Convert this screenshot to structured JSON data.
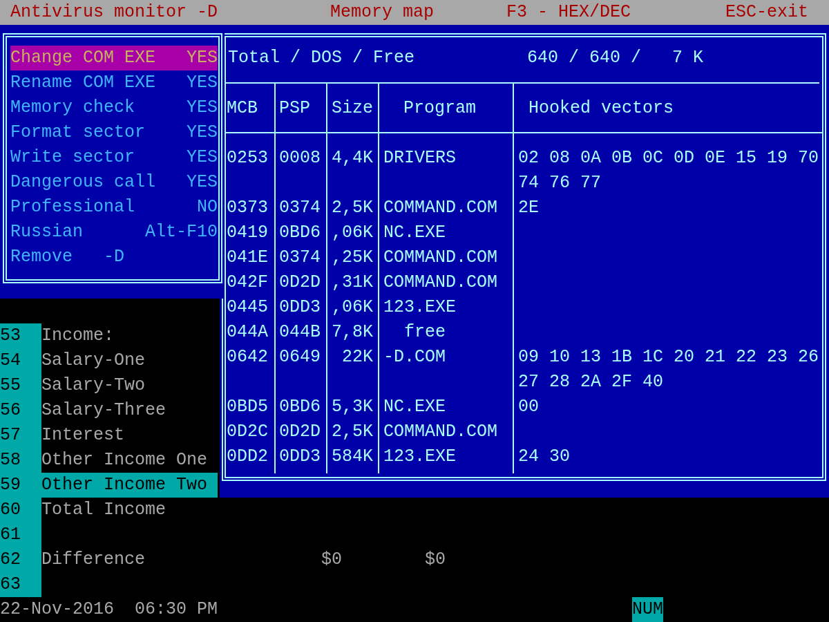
{
  "top_bar": {
    "program": "Antivirus monitor -D",
    "screen": "Memory map",
    "hint": "F3 - HEX/DEC",
    "exit": "ESC-exit"
  },
  "options": [
    {
      "label": "Change COM EXE",
      "value": "YES",
      "selected": true
    },
    {
      "label": "Rename COM EXE",
      "value": "YES",
      "selected": false
    },
    {
      "label": "Memory check",
      "value": "YES",
      "selected": false
    },
    {
      "label": "Format sector",
      "value": "YES",
      "selected": false
    },
    {
      "label": "Write sector",
      "value": "YES",
      "selected": false
    },
    {
      "label": "Dangerous call",
      "value": "YES",
      "selected": false
    },
    {
      "label": "Professional",
      "value": "NO",
      "selected": false
    },
    {
      "label": "Russian",
      "value": "Alt-F10",
      "selected": false
    },
    {
      "label": "Remove   -D",
      "selected": false
    }
  ],
  "memory_map": {
    "summary_label": "Total / DOS / Free",
    "summary_values": "640 / 640 /   7 K",
    "columns": [
      "MCB",
      "PSP",
      "Size",
      "Program",
      "Hooked vectors"
    ],
    "rows": [
      {
        "kind": "program",
        "mcb": "0253",
        "psp": "0008",
        "size": "4,4K",
        "program": "DRIVERS",
        "hooked": "02 08 0A 0B 0C 0D 0E 15 19 70 74 76 77"
      },
      {
        "kind": "program",
        "mcb": "0373",
        "psp": "0374",
        "size": "2,5K",
        "program": "COMMAND.COM",
        "hooked": "2E"
      },
      {
        "kind": "program",
        "mcb": "0419",
        "psp": "0BD6",
        "size": ",06K",
        "program": "NC.EXE"
      },
      {
        "kind": "program",
        "mcb": "041E",
        "psp": "0374",
        "size": ",25K",
        "program": "COMMAND.COM"
      },
      {
        "kind": "program",
        "mcb": "042F",
        "psp": "0D2D",
        "size": ",31K",
        "program": "COMMAND.COM"
      },
      {
        "kind": "program",
        "mcb": "0445",
        "psp": "0DD3",
        "size": ",06K",
        "program": "123.EXE"
      },
      {
        "kind": "free",
        "mcb": "044A",
        "psp": "044B",
        "size": "7,8K",
        "program": "free"
      },
      {
        "kind": "program",
        "mcb": "0642",
        "psp": "0649",
        "size": "22K",
        "program": "-D.COM",
        "hooked": "09 10 13 1B 1C 20 21 22 23 26 27 28 2A 2F 40"
      },
      {
        "kind": "program",
        "mcb": "0BD5",
        "psp": "0BD6",
        "size": "5,3K",
        "program": "NC.EXE",
        "hooked": "00"
      },
      {
        "kind": "program",
        "mcb": "0D2C",
        "psp": "0D2D",
        "size": "2,5K",
        "program": "COMMAND.COM"
      },
      {
        "kind": "program",
        "mcb": "0DD2",
        "psp": "0DD3",
        "size": "584K",
        "program": "123.EXE",
        "hooked": "24 30"
      }
    ]
  },
  "spreadsheet": {
    "rows": [
      {
        "number": "53",
        "label": "Income:",
        "selected": false
      },
      {
        "number": "54",
        "label": "Salary-One",
        "selected": false
      },
      {
        "number": "55",
        "label": "Salary-Two",
        "selected": false
      },
      {
        "number": "56",
        "label": "Salary-Three",
        "selected": false
      },
      {
        "number": "57",
        "label": "Interest",
        "selected": false
      },
      {
        "number": "58",
        "label": "Other Income One",
        "selected": false
      },
      {
        "number": "59",
        "label": "Other Income Two",
        "selected": true
      },
      {
        "number": "60",
        "label": "Total Income",
        "selected": false
      },
      {
        "number": "61",
        "selected": false
      },
      {
        "number": "62",
        "label": "Difference",
        "values": [
          "$0",
          "$0"
        ],
        "selected": false
      },
      {
        "number": "63",
        "selected": false
      }
    ]
  },
  "status_bar": {
    "datetime": "22-Nov-2016  06:30 PM",
    "indicator": "NUM"
  }
}
